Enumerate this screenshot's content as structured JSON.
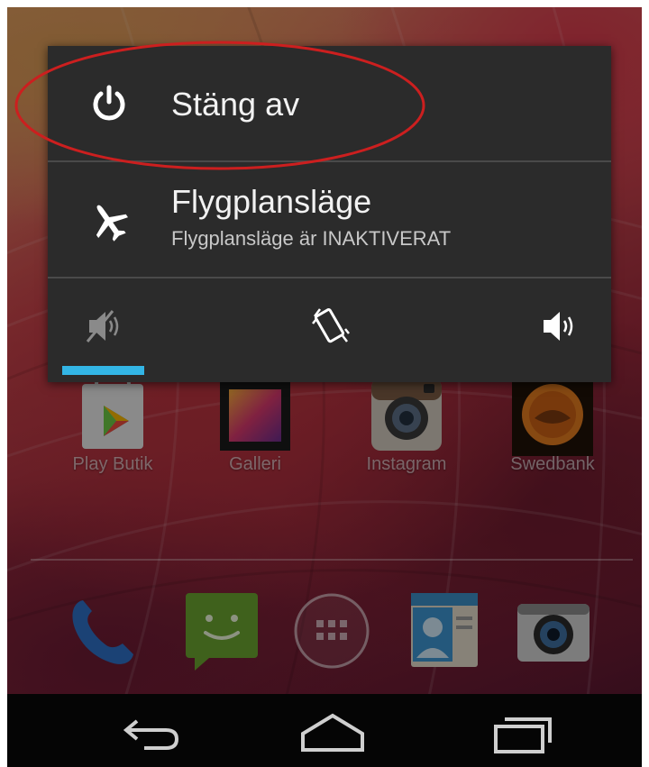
{
  "home": {
    "apps": [
      {
        "label": "Play Butik",
        "icon": "play-store-icon"
      },
      {
        "label": "Galleri",
        "icon": "gallery-icon"
      },
      {
        "label": "Instagram",
        "icon": "instagram-icon"
      },
      {
        "label": "Swedbank",
        "icon": "swedbank-icon"
      }
    ],
    "dock": [
      "phone-icon",
      "messaging-icon",
      "app-drawer-icon",
      "contacts-icon",
      "camera-icon"
    ]
  },
  "power_menu": {
    "power_off": {
      "label": "Stäng av",
      "icon": "power-icon"
    },
    "airplane_mode": {
      "title": "Flygplansläge",
      "status": "Flygplansläge är INAKTIVERAT",
      "icon": "airplane-icon"
    },
    "sound_modes": {
      "options": [
        "silent-icon",
        "vibrate-icon",
        "sound-on-icon"
      ],
      "selected": "silent-icon",
      "indicator_color": "#33b5e5"
    }
  },
  "annotation": {
    "color": "#cc1f1f"
  },
  "navigation_bar": [
    "back-icon",
    "home-icon",
    "recent-apps-icon"
  ]
}
